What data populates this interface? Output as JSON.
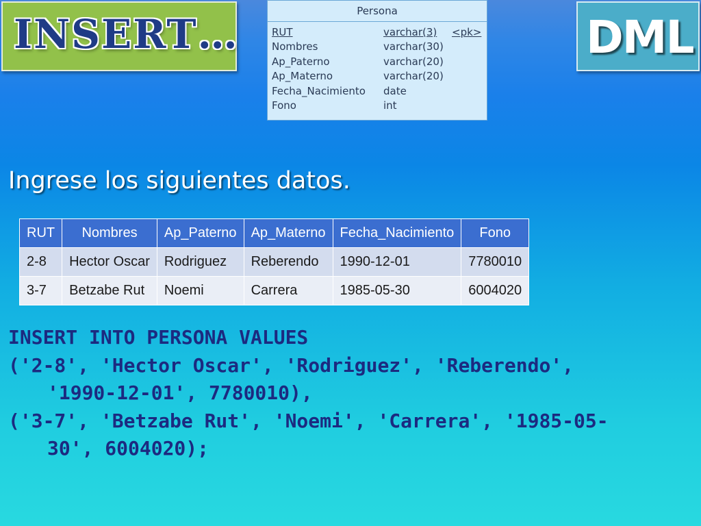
{
  "header": {
    "title": "INSERT…",
    "badge": "DML"
  },
  "entity": {
    "name": "Persona",
    "attributes": [
      {
        "name": "RUT",
        "type": "varchar(3)",
        "key": "<pk>"
      },
      {
        "name": "Nombres",
        "type": "varchar(30)",
        "key": ""
      },
      {
        "name": "Ap_Paterno",
        "type": "varchar(20)",
        "key": ""
      },
      {
        "name": "Ap_Materno",
        "type": "varchar(20)",
        "key": ""
      },
      {
        "name": "Fecha_Nacimiento",
        "type": "date",
        "key": ""
      },
      {
        "name": "Fono",
        "type": "int",
        "key": ""
      }
    ]
  },
  "instruction": "Ingrese los siguientes datos.",
  "table": {
    "headers": [
      "RUT",
      "Nombres",
      "Ap_Paterno",
      "Ap_Materno",
      "Fecha_Nacimiento",
      "Fono"
    ],
    "rows": [
      [
        "2-8",
        "Hector Oscar",
        "Rodriguez",
        "Reberendo",
        "1990-12-01",
        "7780010"
      ],
      [
        "3-7",
        "Betzabe Rut",
        "Noemi",
        "Carrera",
        "1985-05-30",
        "6004020"
      ]
    ]
  },
  "sql": {
    "line1": "INSERT INTO PERSONA VALUES",
    "line2": "('2-8', 'Hector Oscar', 'Rodriguez', 'Reberendo',",
    "line3": "'1990-12-01', 7780010),",
    "line4": "('3-7', 'Betzabe Rut', 'Noemi', 'Carrera', '1985-05-",
    "line5": "30', 6004020);"
  },
  "colors": {
    "title_box": "#92c14a",
    "title_text": "#1f3b86",
    "badge_box": "#4badc9",
    "table_header": "#3b6ed0",
    "sql_text": "#1c2a80"
  }
}
